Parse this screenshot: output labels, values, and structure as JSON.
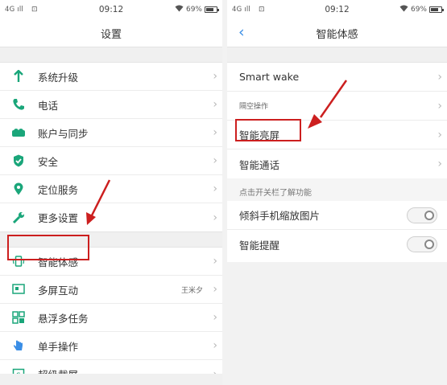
{
  "left": {
    "status": {
      "signal": "4G ıll",
      "notif": "⊡",
      "time": "09:12",
      "battery": "69%"
    },
    "title": "设置",
    "group1": [
      {
        "label": "系统升级",
        "icon": "arrow-up-icon"
      },
      {
        "label": "电话",
        "icon": "phone-icon"
      },
      {
        "label": "账户与同步",
        "icon": "account-icon"
      },
      {
        "label": "安全",
        "icon": "shield-icon"
      },
      {
        "label": "定位服务",
        "icon": "location-icon"
      },
      {
        "label": "更多设置",
        "icon": "wrench-icon"
      }
    ],
    "group2": [
      {
        "label": "智能体感",
        "icon": "phone-motion-icon",
        "extra": ""
      },
      {
        "label": "多屏互动",
        "icon": "multiscreen-icon",
        "extra": "王米夕"
      },
      {
        "label": "悬浮多任务",
        "icon": "float-task-icon",
        "extra": ""
      },
      {
        "label": "单手操作",
        "icon": "hand-icon",
        "extra": ""
      },
      {
        "label": "超级截屏",
        "icon": "screenshot-icon",
        "extra": ""
      }
    ]
  },
  "right": {
    "status": {
      "signal": "4G ıll",
      "notif": "⊡",
      "time": "09:12",
      "battery": "69%"
    },
    "title": "智能体感",
    "group1": [
      {
        "label": "Smart wake"
      },
      {
        "label": "隔空操作"
      },
      {
        "label": "智能亮屏"
      },
      {
        "label": "智能通话"
      }
    ],
    "section_label": "点击开关栏了解功能",
    "toggles": [
      {
        "label": "倾斜手机缩放图片"
      },
      {
        "label": "智能提醒"
      }
    ]
  },
  "colors": {
    "highlight": "#cc1f1f",
    "accent_green": "#1aa67a",
    "accent_blue": "#3a8ee6"
  }
}
